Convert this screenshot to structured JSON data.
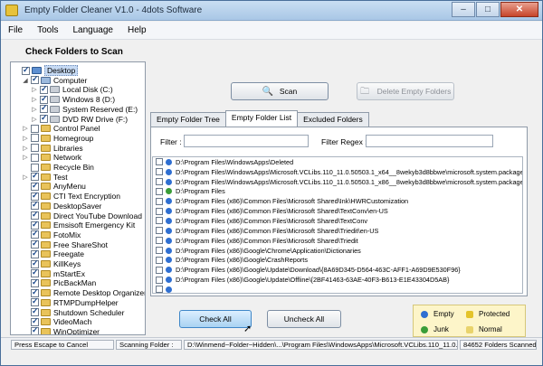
{
  "window": {
    "title": "Empty Folder Cleaner V1.0 - 4dots Software",
    "btn_min": "–",
    "btn_max": "□",
    "btn_close": "✕"
  },
  "menu": [
    "File",
    "Tools",
    "Language",
    "Help"
  ],
  "left": {
    "header": "Check Folders to Scan",
    "tree": [
      {
        "label": "Desktop",
        "indent": 0,
        "toggle": "",
        "checked": true,
        "icon": "desk",
        "selected": true
      },
      {
        "label": "Computer",
        "indent": 1,
        "toggle": "◢",
        "checked": true,
        "icon": "comp"
      },
      {
        "label": "Local Disk (C:)",
        "indent": 2,
        "toggle": "▷",
        "checked": true,
        "icon": "drive"
      },
      {
        "label": "Windows 8 (D:)",
        "indent": 2,
        "toggle": "▷",
        "checked": true,
        "icon": "drive"
      },
      {
        "label": "System Reserved (E:)",
        "indent": 2,
        "toggle": "▷",
        "checked": true,
        "icon": "drive"
      },
      {
        "label": "DVD RW Drive (F:)",
        "indent": 2,
        "toggle": "▷",
        "checked": true,
        "icon": "drive"
      },
      {
        "label": "Control Panel",
        "indent": 1,
        "toggle": "▷",
        "checked": false,
        "icon": "folder"
      },
      {
        "label": "Homegroup",
        "indent": 1,
        "toggle": "▷",
        "checked": false,
        "icon": "folder"
      },
      {
        "label": "Libraries",
        "indent": 1,
        "toggle": "▷",
        "checked": false,
        "icon": "folder"
      },
      {
        "label": "Network",
        "indent": 1,
        "toggle": "▷",
        "checked": false,
        "icon": "folder"
      },
      {
        "label": "Recycle Bin",
        "indent": 1,
        "toggle": "",
        "checked": false,
        "icon": "folder"
      },
      {
        "label": "Test",
        "indent": 1,
        "toggle": "▷",
        "checked": true,
        "icon": "folder"
      },
      {
        "label": "AnyMenu",
        "indent": 1,
        "toggle": "",
        "checked": true,
        "icon": "folder"
      },
      {
        "label": "CTI Text Encryption",
        "indent": 1,
        "toggle": "",
        "checked": true,
        "icon": "folder"
      },
      {
        "label": "DesktopSaver",
        "indent": 1,
        "toggle": "",
        "checked": true,
        "icon": "folder"
      },
      {
        "label": "Direct YouTube Download",
        "indent": 1,
        "toggle": "",
        "checked": true,
        "icon": "folder"
      },
      {
        "label": "Emsisoft Emergency Kit",
        "indent": 1,
        "toggle": "",
        "checked": true,
        "icon": "folder"
      },
      {
        "label": "FotoMix",
        "indent": 1,
        "toggle": "",
        "checked": true,
        "icon": "folder"
      },
      {
        "label": "Free ShareShot",
        "indent": 1,
        "toggle": "",
        "checked": true,
        "icon": "folder"
      },
      {
        "label": "Freegate",
        "indent": 1,
        "toggle": "",
        "checked": true,
        "icon": "folder"
      },
      {
        "label": "KillKeys",
        "indent": 1,
        "toggle": "",
        "checked": true,
        "icon": "folder"
      },
      {
        "label": "mStartEx",
        "indent": 1,
        "toggle": "",
        "checked": true,
        "icon": "folder"
      },
      {
        "label": "PicBackMan",
        "indent": 1,
        "toggle": "",
        "checked": true,
        "icon": "folder"
      },
      {
        "label": "Remote Desktop Organizer",
        "indent": 1,
        "toggle": "",
        "checked": true,
        "icon": "folder"
      },
      {
        "label": "RTMPDumpHelper",
        "indent": 1,
        "toggle": "",
        "checked": true,
        "icon": "folder"
      },
      {
        "label": "Shutdown Scheduler",
        "indent": 1,
        "toggle": "",
        "checked": true,
        "icon": "folder"
      },
      {
        "label": "VideoMach",
        "indent": 1,
        "toggle": "",
        "checked": true,
        "icon": "folder"
      },
      {
        "label": "WinOptimizer",
        "indent": 1,
        "toggle": "",
        "checked": true,
        "icon": "folder"
      }
    ]
  },
  "toolbar": {
    "scan_label": "Scan",
    "delete_label": "Delete Empty Folders"
  },
  "tabs": [
    "Empty Folder Tree",
    "Empty Folder List",
    "Excluded Folders"
  ],
  "filter": {
    "filter_label": "Filter :",
    "regex_label": "Filter Regex :",
    "filter_value": "",
    "regex_value": ""
  },
  "list": [
    {
      "path": "D:\\Program Files\\WindowsApps\\Deleted",
      "type": "empty"
    },
    {
      "path": "D:\\Program Files\\WindowsApps\\Microsoft.VCLibs.110_11.0.50503.1_x64__8wekyb3d8bbwe\\microsoft.system.package.metadat",
      "type": "empty"
    },
    {
      "path": "D:\\Program Files\\WindowsApps\\Microsoft.VCLibs.110_11.0.50503.1_x86__8wekyb3d8bbwe\\microsoft.system.package.metadat",
      "type": "empty"
    },
    {
      "path": "D:\\Program Files",
      "type": "junk"
    },
    {
      "path": "D:\\Program Files (x86)\\Common Files\\Microsoft Shared\\Ink\\HWRCustomization",
      "type": "empty"
    },
    {
      "path": "D:\\Program Files (x86)\\Common Files\\Microsoft Shared\\TextConv\\en-US",
      "type": "empty"
    },
    {
      "path": "D:\\Program Files (x86)\\Common Files\\Microsoft Shared\\TextConv",
      "type": "empty"
    },
    {
      "path": "D:\\Program Files (x86)\\Common Files\\Microsoft Shared\\Triedit\\en-US",
      "type": "empty"
    },
    {
      "path": "D:\\Program Files (x86)\\Common Files\\Microsoft Shared\\Triedit",
      "type": "empty"
    },
    {
      "path": "D:\\Program Files (x86)\\Google\\Chrome\\Application\\Dictionaries",
      "type": "empty"
    },
    {
      "path": "D:\\Program Files (x86)\\Google\\CrashReports",
      "type": "empty"
    },
    {
      "path": "D:\\Program Files (x86)\\Google\\Update\\Download\\{8A69D345-D564-463C-AFF1-A69D9E530F96}",
      "type": "empty"
    },
    {
      "path": "D:\\Program Files (x86)\\Google\\Update\\Offline\\{2BF41463-63AE-40F3-B613-E1E43304D5AB}",
      "type": "empty"
    },
    {
      "path": "",
      "type": "empty"
    }
  ],
  "bottom": {
    "check_all": "Check All",
    "uncheck_all": "Uncheck All"
  },
  "legend": {
    "empty": "Empty",
    "protected": "Protected",
    "junk": "Junk",
    "normal": "Normal"
  },
  "status": {
    "escape": "Press Escape to Cancel",
    "scanning_label": "Scanning Folder :",
    "scanning_path": "D:\\Winmend~Folder~Hidden\\...\\Program Files\\WindowsApps\\Microsoft.VCLibs.110_11.0.50503.1",
    "count": "84652 Folders Scanned"
  },
  "colors": {
    "empty_dot": "#2f6fd1",
    "junk_dot": "#3a9d38",
    "protected": "#e4c32a",
    "legend_bg": "#fdf5c9"
  }
}
